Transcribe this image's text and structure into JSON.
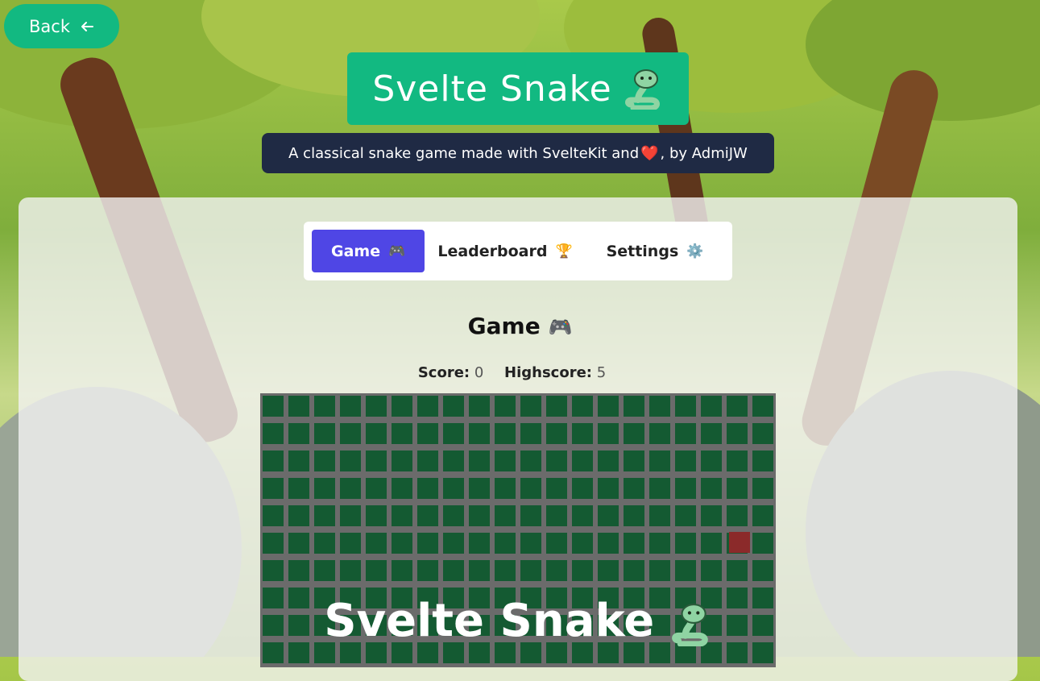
{
  "header": {
    "back_label": "Back",
    "back_icon": "arrow-left-icon",
    "title": "Svelte Snake",
    "title_icon": "snake-icon",
    "subtitle_pre": "A classical snake game made with SvelteKit and ",
    "subtitle_heart": "❤️",
    "subtitle_post": ", by AdmiJW"
  },
  "tabs": [
    {
      "label": "Game",
      "icon": "🎮",
      "active": true
    },
    {
      "label": "Leaderboard",
      "icon": "🏆",
      "active": false
    },
    {
      "label": "Settings",
      "icon": "⚙️",
      "active": false
    }
  ],
  "game": {
    "heading": "Game",
    "heading_icon": "🎮",
    "score_label": "Score:",
    "score_value": "0",
    "highscore_label": "Highscore:",
    "highscore_value": "5",
    "overlay_title": "Svelte Snake"
  },
  "colors": {
    "accent_green": "#12b981",
    "tab_active": "#4f46e5",
    "subtitle_bg": "#1f2a44",
    "board_cell": "#145a32",
    "food": "#8b2a2a"
  }
}
